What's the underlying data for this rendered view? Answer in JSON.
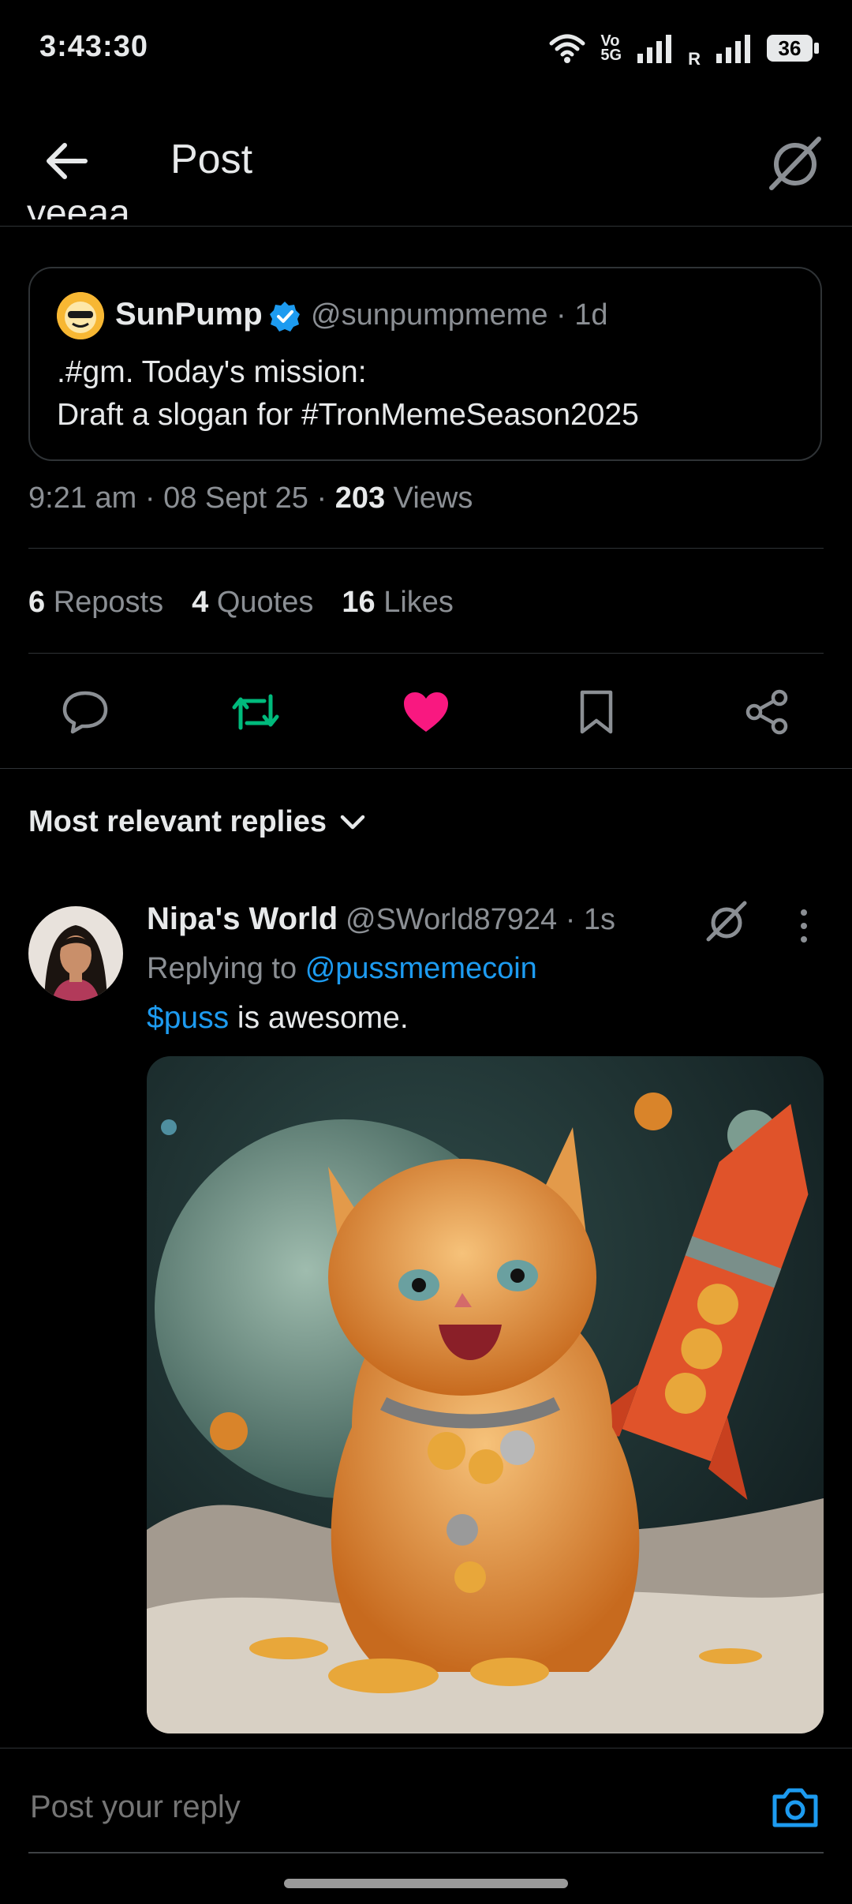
{
  "status_bar": {
    "time": "3:43:30",
    "network_label_top": "Vo",
    "network_label_bottom": "5G",
    "sim2_label": "R",
    "battery": "36"
  },
  "header": {
    "title": "Post"
  },
  "post": {
    "text_cutoff": "yeeaa",
    "time": "9:21 am",
    "date": "08 Sept 25",
    "views_count": "203",
    "views_label": "Views"
  },
  "quote": {
    "name": "SunPump",
    "handle": "@sunpumpmeme",
    "age": "1d",
    "line1": ".#gm. Today's mission:",
    "line2": "Draft a slogan for #TronMemeSeason2025"
  },
  "stats": {
    "reposts_count": "6",
    "reposts_label": "Reposts",
    "quotes_count": "4",
    "quotes_label": "Quotes",
    "likes_count": "16",
    "likes_label": "Likes"
  },
  "actions": {
    "repost_color": "#00ba7c",
    "like_color": "#f91880"
  },
  "sort": {
    "label": "Most relevant replies"
  },
  "reply": {
    "name": "Nipa's World",
    "handle": "@SWorld87924",
    "age": "1s",
    "replying_to_label": "Replying to",
    "replying_to_handle": "@pussmemecoin",
    "cashtag": "$puss",
    "body_rest": " is awesome."
  },
  "composer": {
    "placeholder": "Post your reply"
  }
}
